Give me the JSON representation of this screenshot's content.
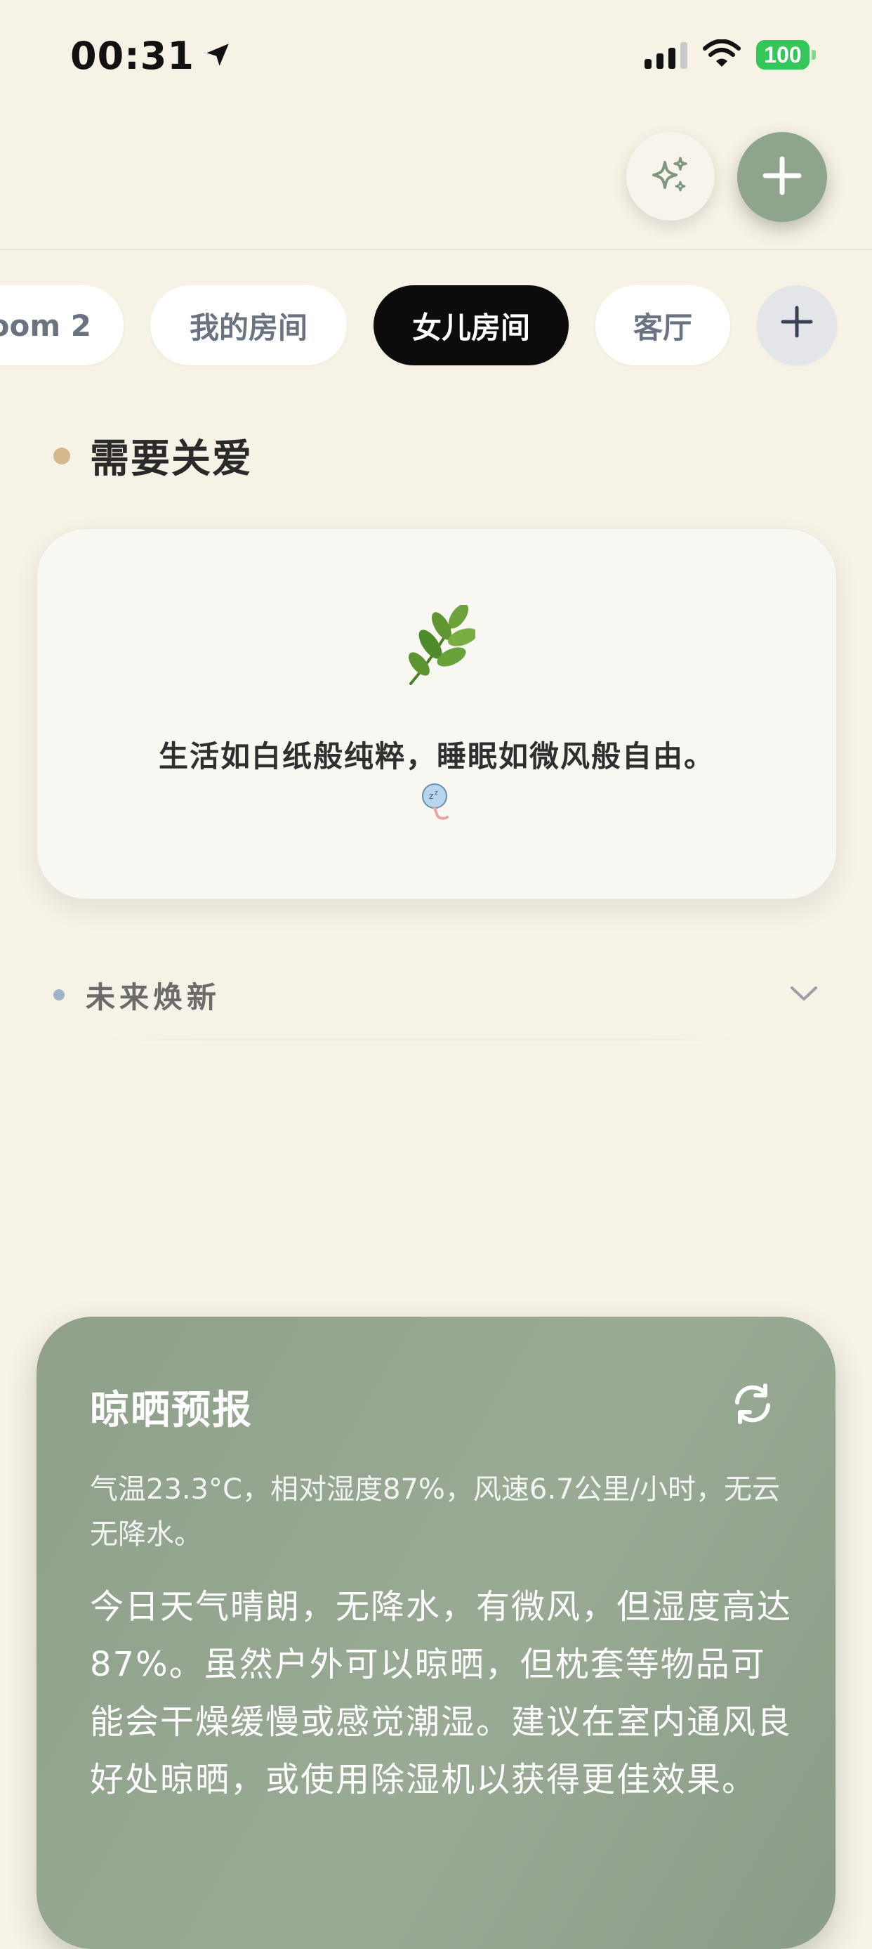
{
  "status_bar": {
    "time": "00:31",
    "battery": "100",
    "icons": [
      "location-arrow-icon",
      "cellular-signal-icon",
      "wifi-icon",
      "battery-icon"
    ]
  },
  "header": {
    "actions": [
      "sparkle-icon",
      "plus-icon"
    ]
  },
  "room_tabs": {
    "items": [
      {
        "label": "oom 2",
        "active": false
      },
      {
        "label": "我的房间",
        "active": false
      },
      {
        "label": "女儿房间",
        "active": true
      },
      {
        "label": "客厅",
        "active": false
      }
    ],
    "add_icon": "plus-icon"
  },
  "needs_care": {
    "title": "需要关爱",
    "accent_color": "#d3b98d",
    "card": {
      "icon": "herb-leaf-icon",
      "quote": "生活如白纸般纯粹，睡眠如微风般自由。",
      "sleep_icon": "sleep-icon"
    }
  },
  "future_refresh": {
    "label": "未来焕新",
    "accent_color": "#9fb3c8",
    "expand_icon": "chevron-down-icon"
  },
  "weather": {
    "title": "晾晒预报",
    "refresh_icon": "refresh-icon",
    "summary": "气温23.3°C，相对湿度87%，风速6.7公里/小时，无云无降水。",
    "advice": "今日天气晴朗，无降水，有微风，但湿度高达87%。虽然户外可以晾晒，但枕套等物品可能会干燥缓慢或感觉潮湿。建议在室内通风良好处晾晒，或使用除湿机以获得更佳效果。",
    "card_color": "#93a58f"
  }
}
